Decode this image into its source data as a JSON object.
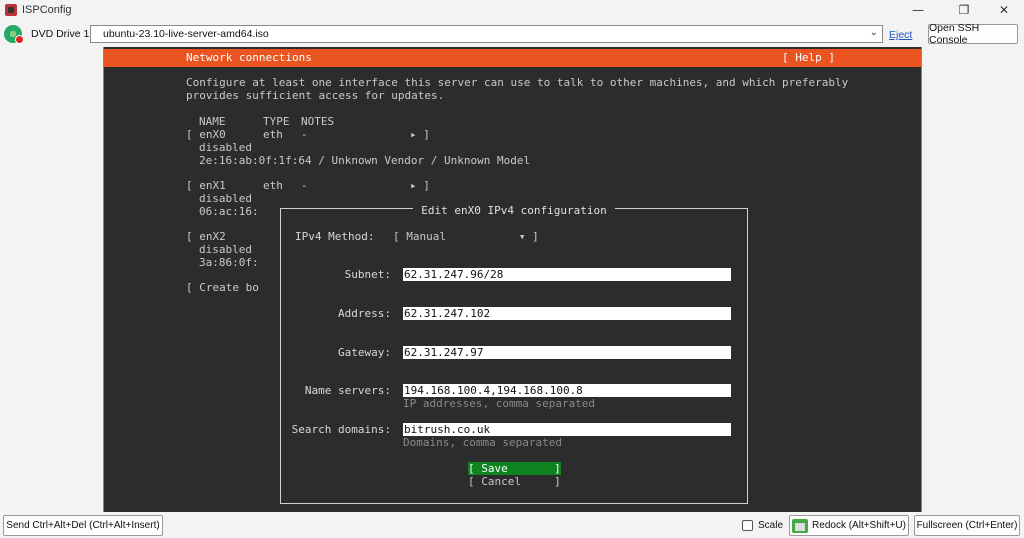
{
  "window": {
    "title": "ISPConfig",
    "controls": {
      "minimize": "—",
      "restore": "❐",
      "close": "✕"
    }
  },
  "toolbar": {
    "drive_label": "DVD Drive 1:",
    "iso_value": "ubuntu-23.10-live-server-amd64.iso",
    "eject_label": "Eject",
    "ssh_button": "Open SSH Console"
  },
  "installer": {
    "header_title": "Network connections",
    "help_label": "[ Help ]",
    "intro_line1": "Configure at least one interface this server can use to talk to other machines, and which preferably",
    "intro_line2": "provides sufficient access for updates.",
    "columns": {
      "name": "NAME",
      "type": "TYPE",
      "notes": "NOTES"
    },
    "interfaces": [
      {
        "bracket": "[ enX0",
        "type": "eth",
        "notes": "-",
        "arrow": "▸ ]",
        "status": "disabled",
        "detail": "2e:16:ab:0f:1f:64 / Unknown Vendor / Unknown Model"
      },
      {
        "bracket": "[ enX1",
        "type": "eth",
        "notes": "-",
        "arrow": "▸ ]",
        "status": "disabled",
        "detail": "06:ac:16:"
      },
      {
        "bracket": "[ enX2",
        "type": "",
        "notes": "",
        "arrow": "",
        "status": "disabled",
        "detail": "3a:86:0f:"
      }
    ],
    "create_bond": "[ Create bo"
  },
  "dialog": {
    "title": "Edit enX0 IPv4 configuration",
    "method_label": "IPv4 Method:",
    "method_value": "[ Manual           ▾ ]",
    "subnet_label": "Subnet:",
    "subnet_value": "62.31.247.96/28",
    "address_label": "Address:",
    "address_value": "62.31.247.102",
    "gateway_label": "Gateway:",
    "gateway_value": "62.31.247.97",
    "nameservers_label": "Name servers:",
    "nameservers_value": "194.168.100.4,194.168.100.8",
    "nameservers_hint": "IP addresses, comma separated",
    "searchdomains_label": "Search domains:",
    "searchdomains_value": "bitrush.co.uk",
    "searchdomains_hint": "Domains, comma separated",
    "save_label": "[ Save       ]",
    "cancel_label": "[ Cancel     ]"
  },
  "bottombar": {
    "send_cad": "Send Ctrl+Alt+Del (Ctrl+Alt+Insert)",
    "scale_label": "Scale",
    "redock": "Redock (Alt+Shift+U)",
    "fullscreen": "Fullscreen (Ctrl+Enter)"
  },
  "colors": {
    "ubuntu_orange": "#e95420",
    "save_green": "#0e8420",
    "terminal_bg": "#2c2c2c"
  }
}
